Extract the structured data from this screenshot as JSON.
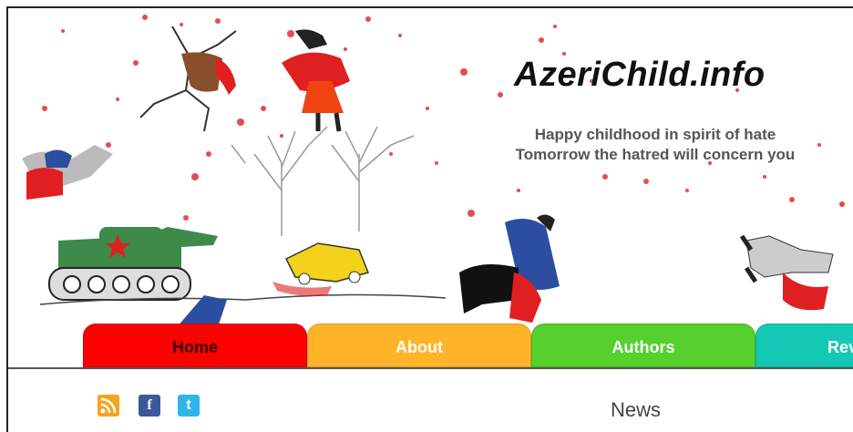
{
  "site": {
    "title": "AzeriChild.info",
    "tagline_line1": "Happy childhood in spirit of hate",
    "tagline_line2": "Tomorrow the hatred will concern you"
  },
  "nav": {
    "tabs": [
      {
        "label": "Home",
        "color": "#ff0000"
      },
      {
        "label": "About",
        "color": "#ffb428"
      },
      {
        "label": "Authors",
        "color": "#55d02d"
      },
      {
        "label": "Rev",
        "color": "#13c9b5"
      }
    ]
  },
  "social": {
    "icons": [
      "rss-icon",
      "facebook-icon",
      "twitter-icon"
    ]
  },
  "main": {
    "section_title": "News"
  }
}
